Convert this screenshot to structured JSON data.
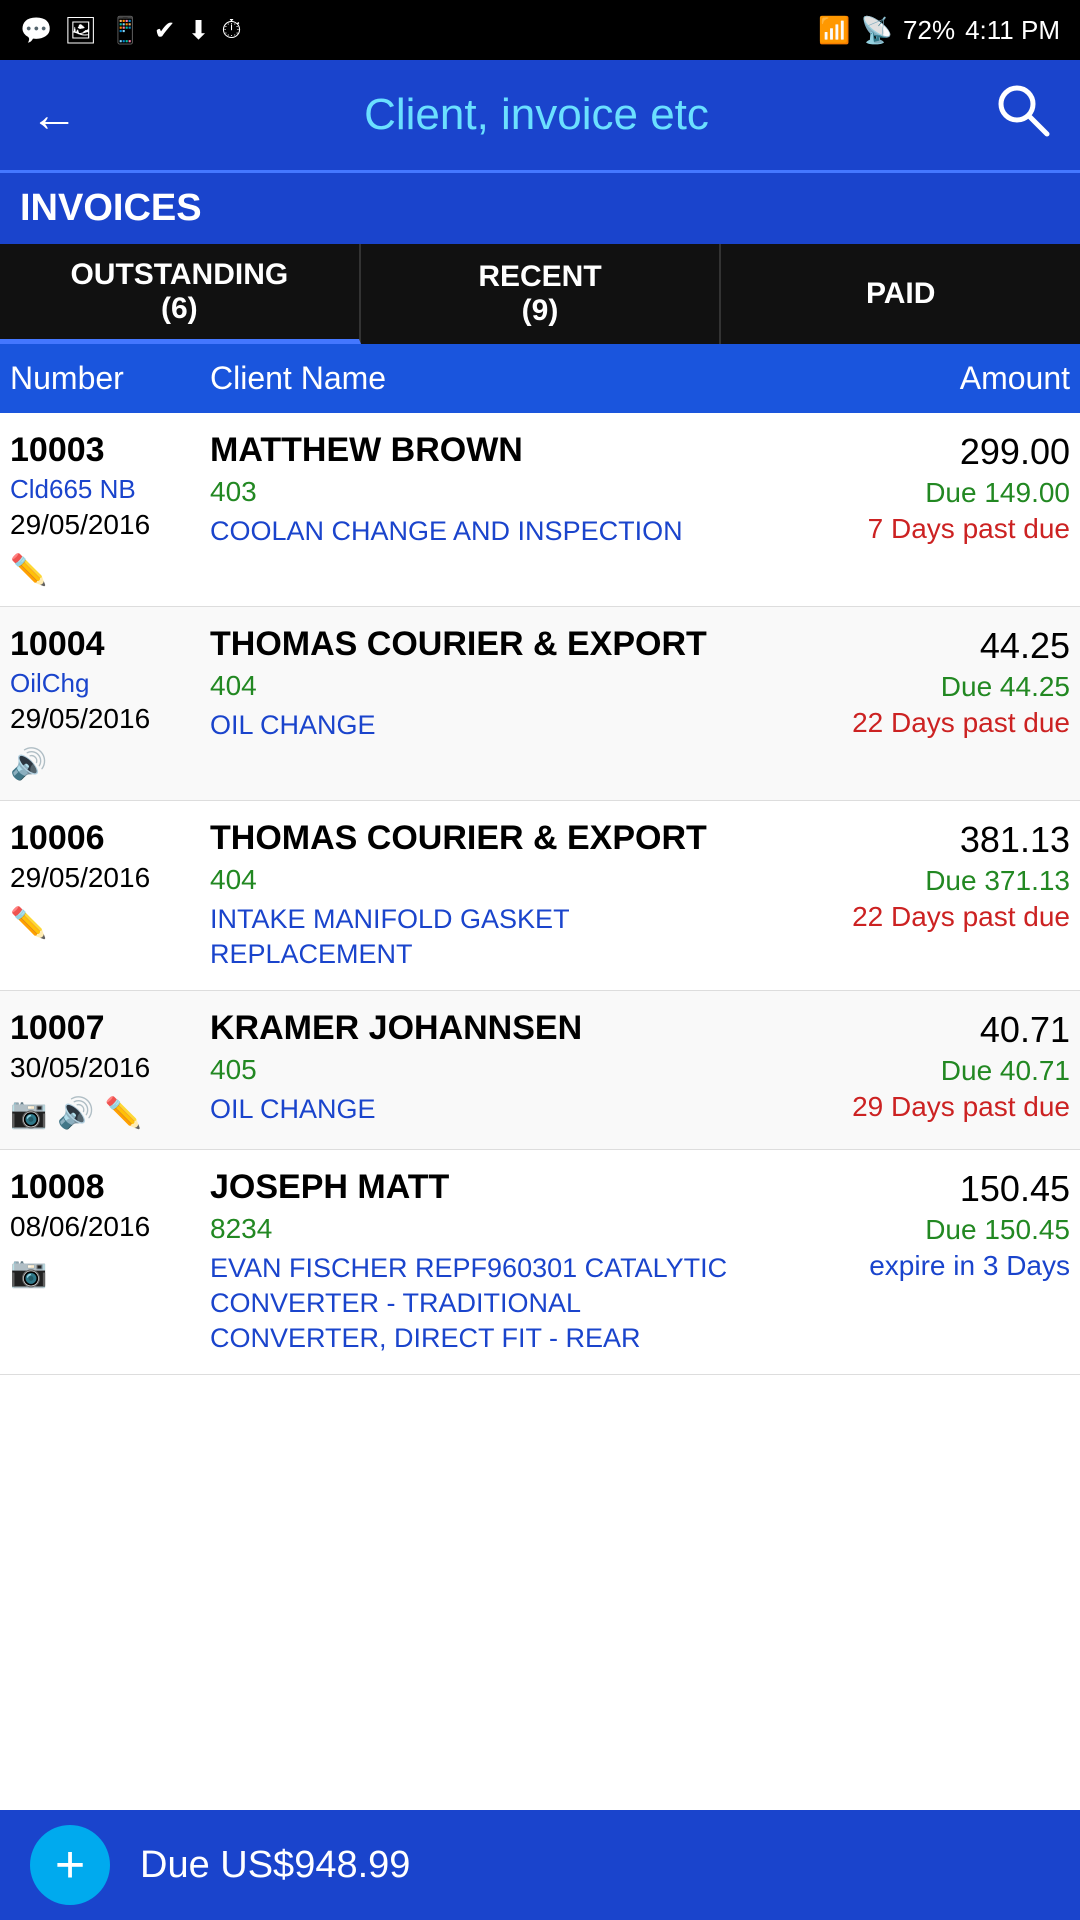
{
  "statusBar": {
    "time": "4:11 PM",
    "battery": "72%",
    "icons": [
      "whatsapp",
      "image",
      "basics",
      "check",
      "download",
      "timer",
      "wifi",
      "signal",
      "battery"
    ]
  },
  "appBar": {
    "title": "Client, invoice etc",
    "backLabel": "←",
    "searchLabel": "🔍"
  },
  "invoicesHeader": {
    "label": "INVOICES"
  },
  "tabs": [
    {
      "label": "OUTSTANDING\n(6)",
      "active": true
    },
    {
      "label": "RECENT\n(9)",
      "active": false
    },
    {
      "label": "PAID",
      "active": false
    }
  ],
  "tableHeader": {
    "number": "Number",
    "clientName": "Client Name",
    "amount": "Amount"
  },
  "invoices": [
    {
      "number": "10003",
      "code": "Cld665 NB",
      "date": "29/05/2016",
      "icons": [
        "pencil"
      ],
      "clientName": "MATTHEW BROWN",
      "jobNum": "403",
      "description": "COOLAN CHANGE AND INSPECTION",
      "amount": "299.00",
      "dueAmount": "Due 149.00",
      "status": "7 Days past due",
      "statusType": "overdue"
    },
    {
      "number": "10004",
      "code": "OilChg",
      "date": "29/05/2016",
      "icons": [
        "speaker"
      ],
      "clientName": "THOMAS  COURIER & EXPORT",
      "jobNum": "404",
      "description": "OIL CHANGE",
      "amount": "44.25",
      "dueAmount": "Due 44.25",
      "status": "22 Days past due",
      "statusType": "overdue"
    },
    {
      "number": "10006",
      "code": "",
      "date": "29/05/2016",
      "icons": [
        "pencil"
      ],
      "clientName": "THOMAS  COURIER & EXPORT",
      "jobNum": "404",
      "description": "INTAKE MANIFOLD GASKET REPLACEMENT",
      "amount": "381.13",
      "dueAmount": "Due 371.13",
      "status": "22 Days past due",
      "statusType": "overdue"
    },
    {
      "number": "10007",
      "code": "",
      "date": "30/05/2016",
      "icons": [
        "camera",
        "speaker",
        "pencil"
      ],
      "clientName": "KRAMER JOHANNSEN",
      "jobNum": "405",
      "description": "OIL CHANGE",
      "amount": "40.71",
      "dueAmount": "Due 40.71",
      "status": "29 Days past due",
      "statusType": "overdue"
    },
    {
      "number": "10008",
      "code": "",
      "date": "08/06/2016",
      "icons": [
        "camera"
      ],
      "clientName": "JOSEPH MATT",
      "jobNum": "8234",
      "description": "EVAN FISCHER REPF960301 CATALYTIC CONVERTER - TRADITIONAL CONVERTER, DIRECT FIT - REAR",
      "amount": "150.45",
      "dueAmount": "Due 150.45",
      "status": "expire in 3 Days",
      "statusType": "expire"
    }
  ],
  "bottomBar": {
    "addLabel": "+",
    "totalLabel": "Due US$948.99"
  }
}
